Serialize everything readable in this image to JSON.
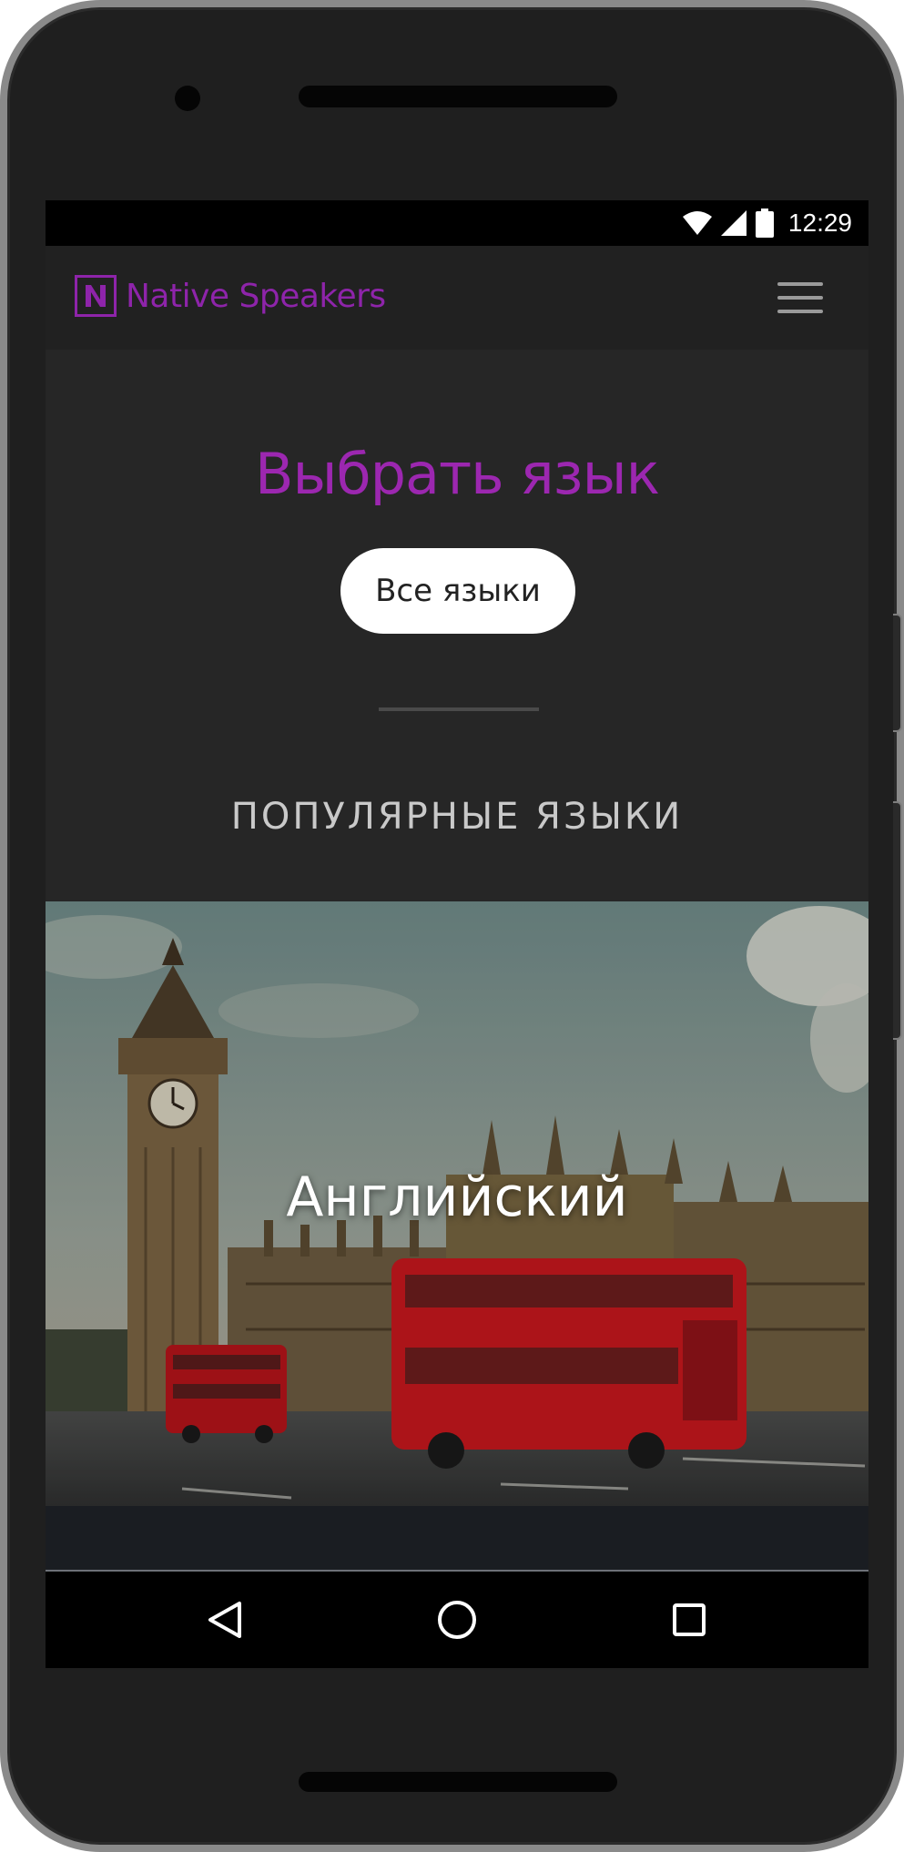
{
  "status_bar": {
    "time": "12:29",
    "icons": [
      "wifi-icon",
      "signal-icon",
      "battery-icon"
    ]
  },
  "header": {
    "logo_letter": "N",
    "brand_name": "Native Speakers",
    "brand_color": "#8e24aa",
    "menu_icon": "hamburger-icon"
  },
  "language_section": {
    "title": "Выбрать язык",
    "all_languages_button": "Все языки",
    "popular_title": "ПОПУЛЯРНЫЕ ЯЗЫКИ"
  },
  "popular_languages": [
    {
      "label": "Английский",
      "image": "london-big-ben-red-bus"
    }
  ],
  "nav_bar": {
    "buttons": [
      "back-icon",
      "home-icon",
      "recents-icon"
    ]
  }
}
